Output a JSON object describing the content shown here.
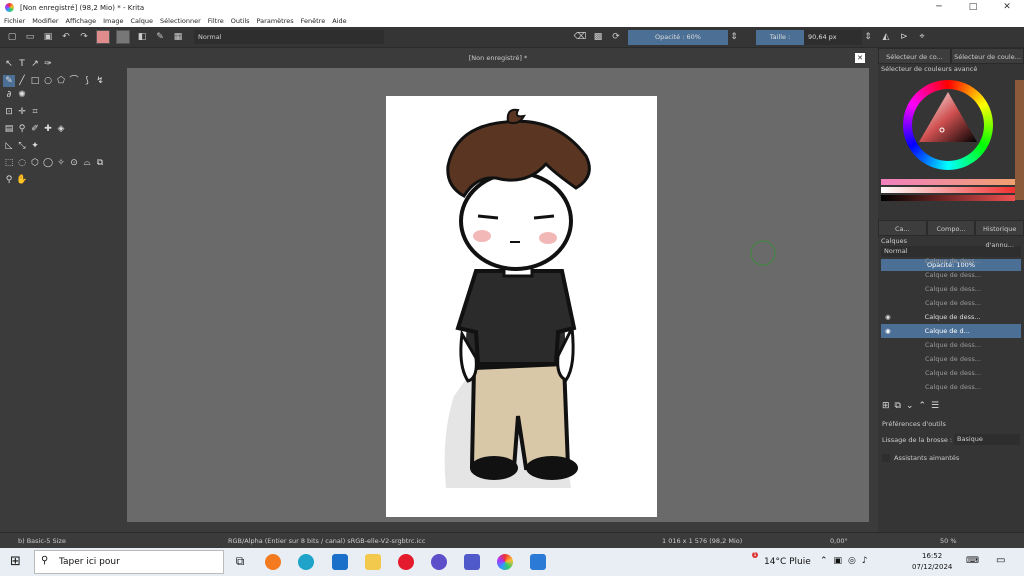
{
  "window": {
    "title": "[Non enregistré]  (98,2 Mio)  * - Krita",
    "minimize": "─",
    "maximize": "□",
    "close": "✕"
  },
  "menu": [
    "Fichier",
    "Modifier",
    "Affichage",
    "Image",
    "Calque",
    "Sélectionner",
    "Filtre",
    "Outils",
    "Paramètres",
    "Fenêtre",
    "Aide"
  ],
  "toolbar": {
    "blend_mode": "Normal",
    "opacity_label": "Opacité : 60%",
    "size_label": "Taille :",
    "size_value": "90,64 px"
  },
  "document_tab": {
    "title": "[Non enregistré]  *",
    "close": "✕"
  },
  "right_panel": {
    "top_tabs": [
      "Sélecteur de co...",
      "Sélecteur de coule..."
    ],
    "color_selector_title": "Sélecteur de couleurs avancé",
    "mid_tabs": [
      "Ca...",
      "Compo...",
      "Historique d'annu..."
    ],
    "layers_title": "Calques",
    "layers_blend": "Normal",
    "layers_opacity": "Opacité:  100%",
    "layers": [
      "Calque de dess...",
      "Calque de dess...",
      "Calque de dess...",
      "Calque de dess...",
      "Calque de dess...",
      "Calque de d...",
      "Calque de dess...",
      "Calque de dess...",
      "Calque de dess...",
      "Calque de dess..."
    ],
    "tool_prefs_title": "Préférences d'outils",
    "smoothing_label": "Lissage de la brosse :",
    "smoothing_value": "Basique",
    "assistants_label": "Assistants aimantés"
  },
  "status": {
    "brush": "b) Basic-5 Size",
    "color_info": "RGB/Alpha (Entier sur 8 bits / canal)  sRGB-elle-V2-srgbtrc.icc",
    "dims": "1 016 x 1 576 (98,2 Mio)",
    "rotation": "0,00°",
    "zoom": "50 %"
  },
  "taskbar": {
    "search_placeholder": "Taper ici pour",
    "weather": "14°C  Pluie",
    "time": "16:52",
    "date": "07/12/2024",
    "notif_count": "1"
  },
  "colors": {
    "accent": "#4b6f95",
    "fg_swatch": "#e08c8c",
    "bg_swatch": "#ffffff"
  }
}
